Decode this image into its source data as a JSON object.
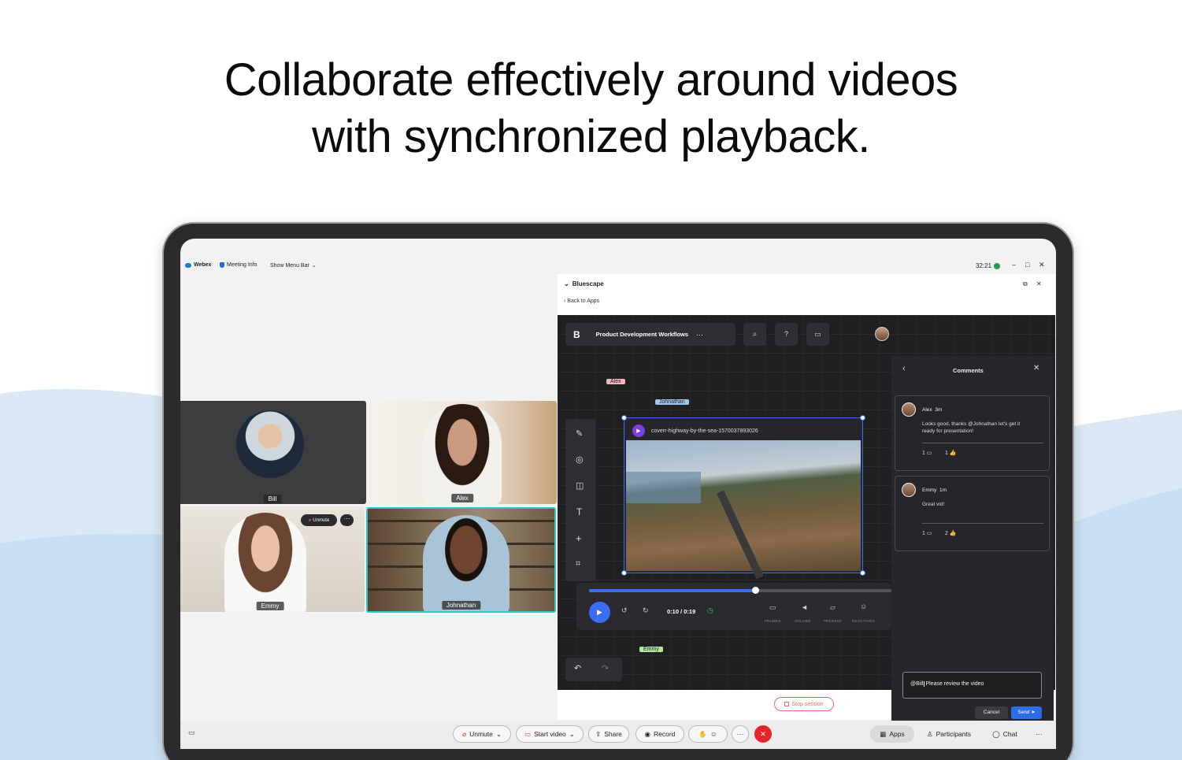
{
  "headline": {
    "line1": "Collaborate effectively around videos",
    "line2": "with synchronized playback."
  },
  "webex_bar": {
    "app_name": "Webex",
    "meeting_info": "Meeting Info",
    "show_menu_bar": "Show Menu Bar",
    "timer": "32:21"
  },
  "participants": [
    {
      "name": "Bill"
    },
    {
      "name": "Alex"
    },
    {
      "name": "Emmy",
      "unmute_label": "Unmute"
    },
    {
      "name": "Johnathan"
    }
  ],
  "bluescape": {
    "title": "Bluescape",
    "back_label": "Back to Apps",
    "workspace_name": "Product Development Workflows",
    "logo_letter": "B",
    "cursors": {
      "alex": "Alex",
      "johnathan": "Johnathan",
      "emmy": "Emmy"
    },
    "video": {
      "filename": "coverr-highway-by-the-sea-1570037893026",
      "time": "0:10 / 0:19",
      "progress": 0.55,
      "controls": [
        "FRAMES",
        "VOLUME",
        "PRESENT",
        "REACTIONS"
      ]
    },
    "comments_panel": {
      "title": "Comments",
      "comments": [
        {
          "author": "Alex",
          "time": "3m",
          "text_line1": "Looks good, thanks @Johnathan let's get it",
          "text_line2": "ready for presentation!",
          "replies": "1",
          "likes": "1"
        },
        {
          "author": "Emmy",
          "time": "1m",
          "text_line1": "Great vid!",
          "text_line2": "",
          "replies": "1",
          "likes": "2"
        }
      ],
      "input_mention": "@Bill",
      "input_text": "Please review the video",
      "cancel_label": "Cancel",
      "send_label": "Send"
    },
    "stop_session": "Stop session"
  },
  "bottom_bar": {
    "unmute": "Unmute",
    "start_video": "Start video",
    "share": "Share",
    "record": "Record",
    "apps": "Apps",
    "participants": "Participants",
    "chat": "Chat"
  },
  "colors": {
    "accent": "#2f6de8",
    "end_call": "#e5242b",
    "teal_border": "#27c9c9"
  }
}
